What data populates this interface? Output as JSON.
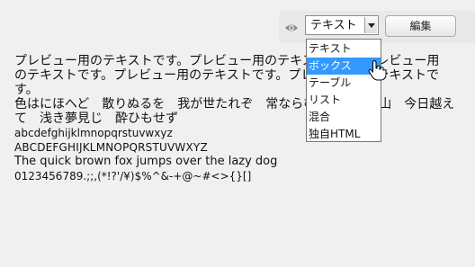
{
  "toolbar": {
    "eye_icon": "eye-icon",
    "select_value": "テキスト",
    "button_label": "編集"
  },
  "dropdown": {
    "options": [
      "テキスト",
      "ボックス",
      "テーブル",
      "リスト",
      "混合",
      "独自HTML"
    ],
    "highlighted": "ボックス"
  },
  "preview": {
    "paragraph": "プレビュー用のテキストです。プレビュー用のテキストです。プレビュー用のテキストです。プレビュー用のテキストです。プレビュー用のテキストです。",
    "iroha": "色はにほへど　散りぬるを　我が世たれぞ　常ならむ　有為の奥山　今日越えて　浅き夢見じ　酔ひもせず",
    "lowercase": "abcdefghijklmnopqrstuvwxyz",
    "uppercase": "ABCDEFGHIJKLMNOPQRSTUVWXYZ",
    "pangram": "The quick brown fox jumps over the lazy dog",
    "digits_symbols": "0123456789.;;,(*!?'/¥)$%^&-+@~#<>{}[]"
  },
  "colors": {
    "highlight": "#3399ff",
    "background": "#f0f0f0"
  }
}
